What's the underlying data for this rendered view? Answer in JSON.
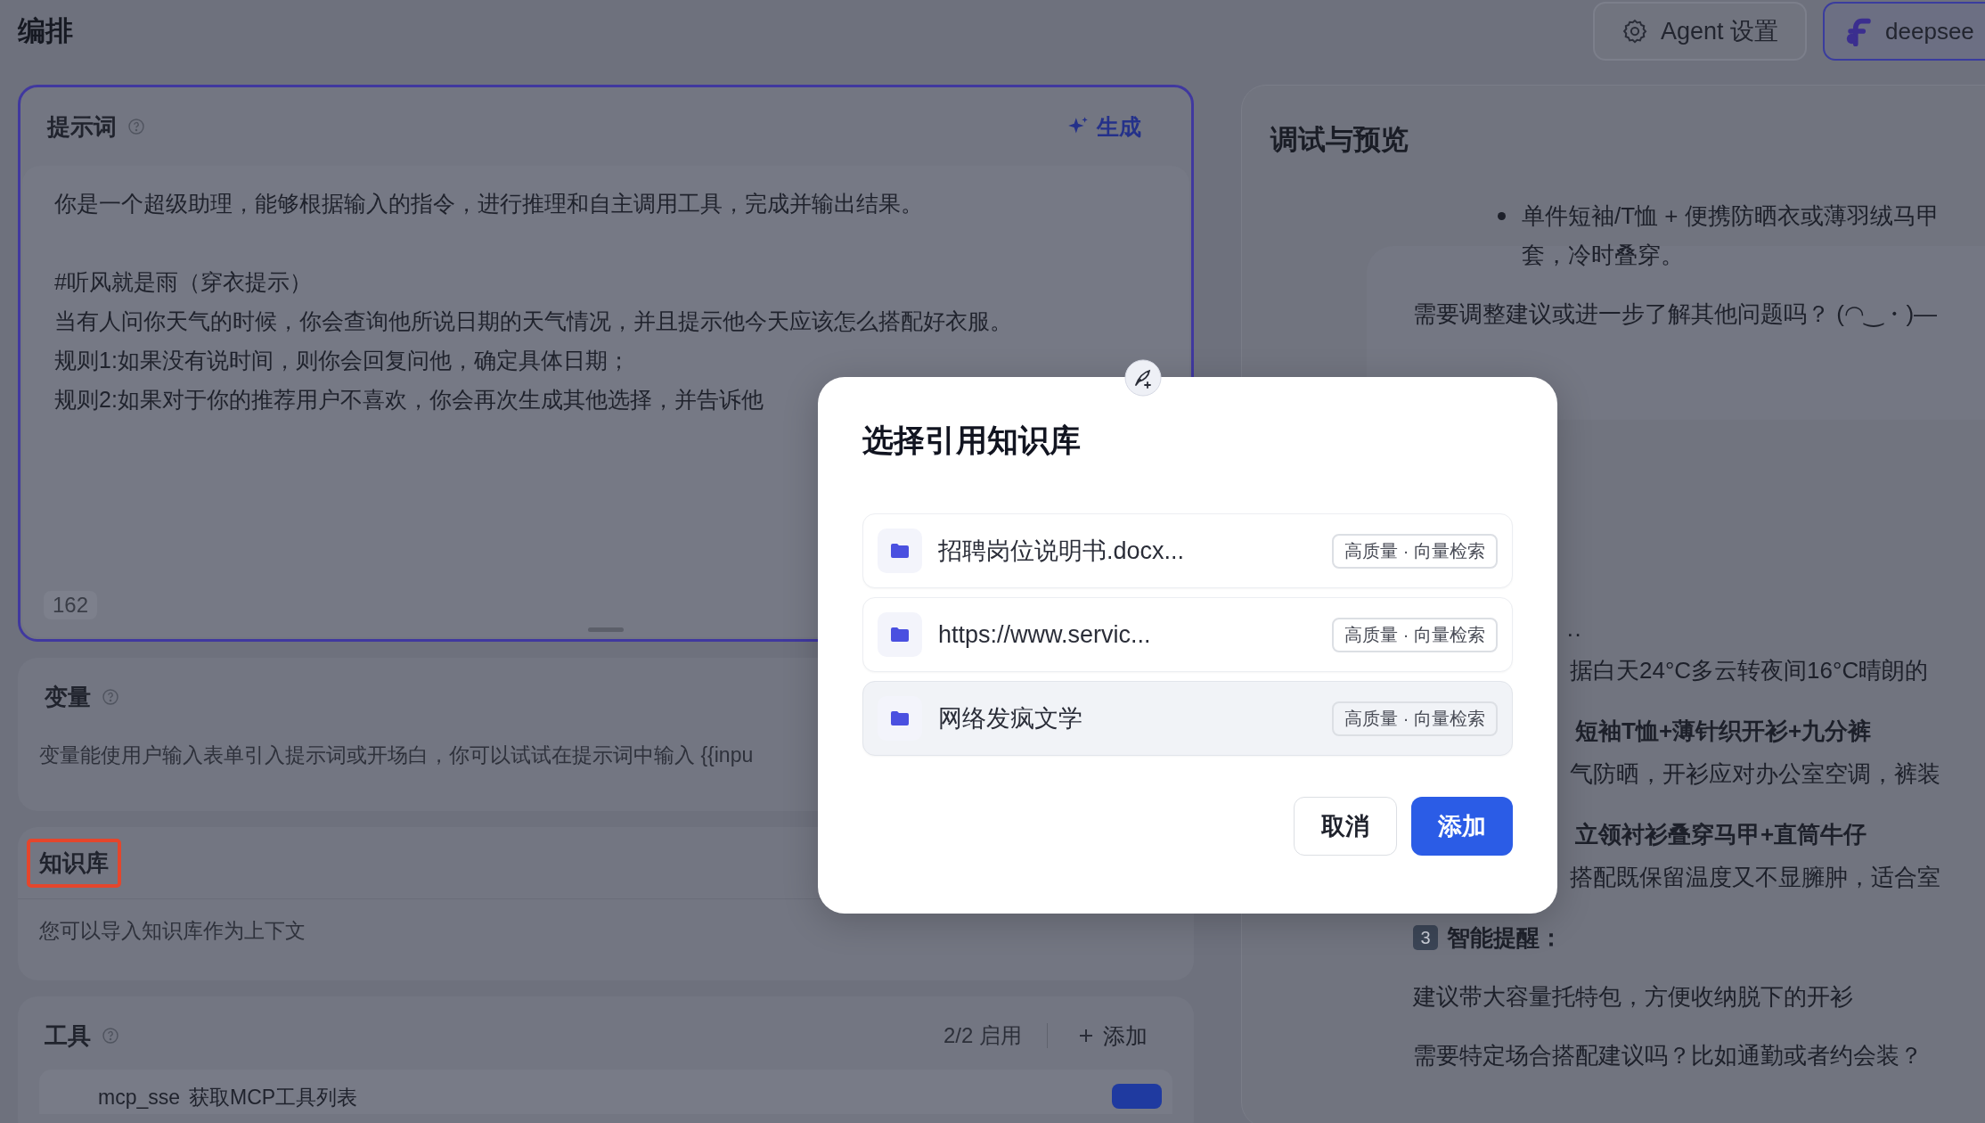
{
  "header": {
    "title": "编排",
    "buttons": [
      {
        "kind": "settings",
        "label": "Agent 设置"
      },
      {
        "kind": "model",
        "label": "deepsee"
      }
    ]
  },
  "prompt": {
    "title": "提示词",
    "generate": "生成",
    "focused": true,
    "paragraphs": [
      [
        "你是一个超级助理，能够根据输入的指令，进行推理和自主调用工具，完成并输出结果。"
      ],
      [
        "#听风就是雨（穿衣提示）",
        "当有人问你天气的时候，你会查询他所说日期的天气情况，并且提示他今天应该怎么搭配好衣服。",
        "规则1:如果没有说时间，则你会回复问他，确定具体日期；",
        "规则2:如果对于你的推荐用户不喜欢，你会再次生成其他选择，并告诉他"
      ]
    ],
    "count": "162"
  },
  "variables": {
    "title": "变量",
    "description": "变量能使用户输入表单引入提示词或开场白，你可以试试在提示词中输入 {{inpu"
  },
  "knowledge": {
    "title": "知识库",
    "highlighted": true,
    "description": "您可以导入知识库作为上下文"
  },
  "tools": {
    "title": "工具",
    "status": "2/2 启用",
    "add": "添加",
    "items": [
      {
        "name": "mcp_sse",
        "description": "获取MCP工具列表",
        "on": true
      }
    ]
  },
  "preview": {
    "title": "调试与预览",
    "messages": [
      {
        "kind": "bullet",
        "text": "单件短袖/T恤 + 便携防晒衣或薄羽绒马甲",
        "continuation": "套，冷时叠穿。"
      },
      {
        "kind": "text",
        "text": "需要调整建议或进一步了解其他问题吗？ (◠‿・)—"
      },
      {
        "kind": "ellipsis",
        "text": "··"
      },
      {
        "kind": "fragment",
        "text": "据白天24°C多云转夜间16°C晴朗的"
      },
      {
        "kind": "fragment_bold",
        "text": "短袖T恤+薄针织开衫+九分裤"
      },
      {
        "kind": "fragment",
        "text": "气防晒，开衫应对办公室空调，裤装"
      },
      {
        "kind": "fragment_bold",
        "text": "立领衬衫叠穿马甲+直筒牛仔"
      },
      {
        "kind": "fragment",
        "text": "搭配既保留温度又不显臃肿，适合室"
      },
      {
        "kind": "keycap_heading",
        "number": "3",
        "text": "智能提醒："
      },
      {
        "kind": "text",
        "text": "建议带大容量托特包，方便收纳脱下的开衫"
      },
      {
        "kind": "text",
        "text": "需要特定场合搭配建议吗？比如通勤或者约会装？"
      }
    ]
  },
  "dialog": {
    "title": "选择引用知识库",
    "items": [
      {
        "name": "招聘岗位说明书.docx...",
        "tag": "高质量 · 向量检索",
        "selected": false
      },
      {
        "name": "https://www.servic...",
        "tag": "高质量 · 向量检索",
        "selected": false
      },
      {
        "name": "网络发疯文学",
        "tag": "高质量 · 向量检索",
        "selected": true
      }
    ],
    "cancel": "取消",
    "confirm": "添加"
  }
}
